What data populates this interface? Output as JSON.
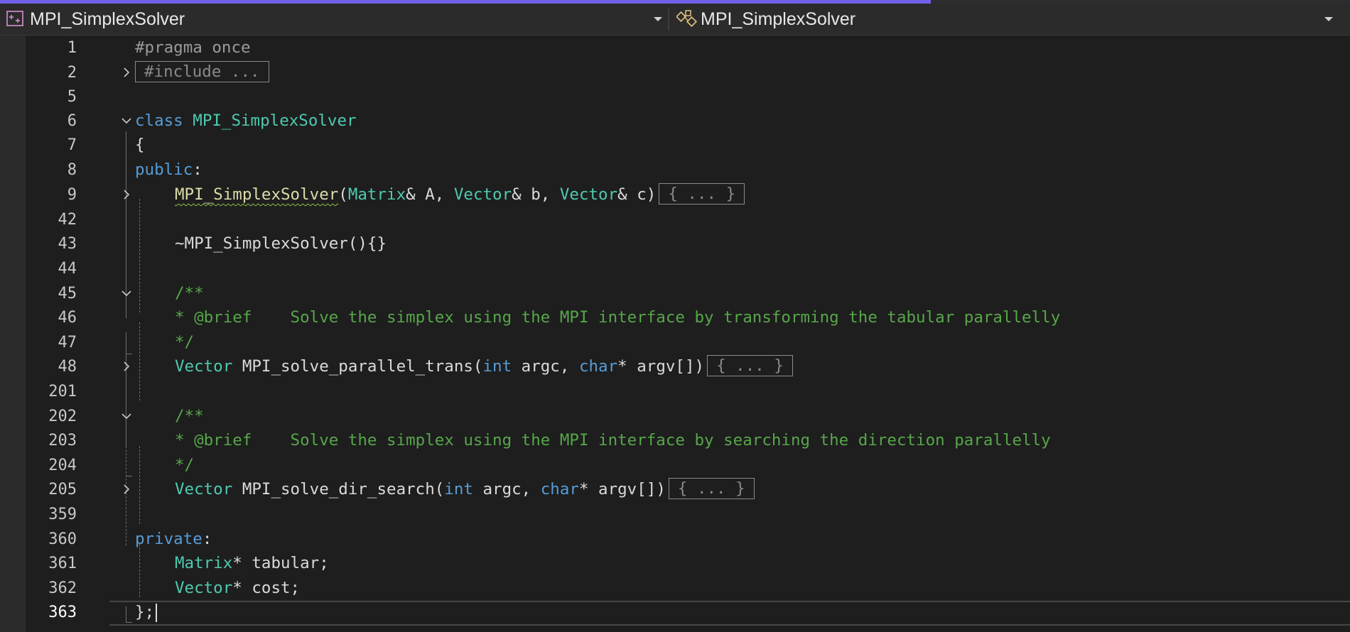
{
  "navbar": {
    "left_dropdown": {
      "label": "MPI_SimplexSolver",
      "icon": "project-icon"
    },
    "right_dropdown": {
      "label": "MPI_SimplexSolver",
      "icon": "class-members-icon"
    }
  },
  "colors": {
    "keyword": "#569cd6",
    "type": "#4ec9b0",
    "comment": "#57a64a",
    "plain": "#dadada",
    "accent": "#7160e8",
    "background": "#1e1e1e"
  },
  "editor": {
    "current_line": "363",
    "lines": [
      {
        "num": "1",
        "t1": "#pragma once"
      },
      {
        "num": "2",
        "collapsed": "#include ..."
      },
      {
        "num": "5"
      },
      {
        "num": "6",
        "kw": "class",
        "ty": "MPI_SimplexSolver"
      },
      {
        "num": "7",
        "t1": "{"
      },
      {
        "num": "8",
        "kw": "public",
        "t1": ":"
      },
      {
        "num": "9",
        "squig": "MPI_SimplexSolver",
        "p1": "(",
        "ty1": "Matrix",
        "p2": "& A, ",
        "ty2": "Vector",
        "p3": "& b, ",
        "ty3": "Vector",
        "p4": "& c)",
        "collapsed": "{ ... }"
      },
      {
        "num": "42"
      },
      {
        "num": "43",
        "t1": "~MPI_SimplexSolver(){}"
      },
      {
        "num": "44"
      },
      {
        "num": "45",
        "cm": "/**"
      },
      {
        "num": "46",
        "cm": "* @brief    Solve the simplex using the MPI interface by transforming the tabular parallelly"
      },
      {
        "num": "47",
        "cm": "*/"
      },
      {
        "num": "48",
        "ty": "Vector",
        "p1": " MPI_solve_parallel_trans(",
        "kw1": "int",
        "p2": " argc, ",
        "kw2": "char",
        "p3": "* argv[])",
        "collapsed": "{ ... }"
      },
      {
        "num": "201"
      },
      {
        "num": "202",
        "cm": "/**"
      },
      {
        "num": "203",
        "cm": "* @brief    Solve the simplex using the MPI interface by searching the direction parallelly"
      },
      {
        "num": "204",
        "cm": "*/"
      },
      {
        "num": "205",
        "ty": "Vector",
        "p1": " MPI_solve_dir_search(",
        "kw1": "int",
        "p2": " argc, ",
        "kw2": "char",
        "p3": "* argv[])",
        "collapsed": "{ ... }"
      },
      {
        "num": "359"
      },
      {
        "num": "360",
        "kw": "private",
        "t1": ":"
      },
      {
        "num": "361",
        "ty": "Matrix",
        "t1": "* tabular;"
      },
      {
        "num": "362",
        "ty": "Vector",
        "t1": "* cost;"
      },
      {
        "num": "363",
        "t1": "};"
      }
    ]
  }
}
